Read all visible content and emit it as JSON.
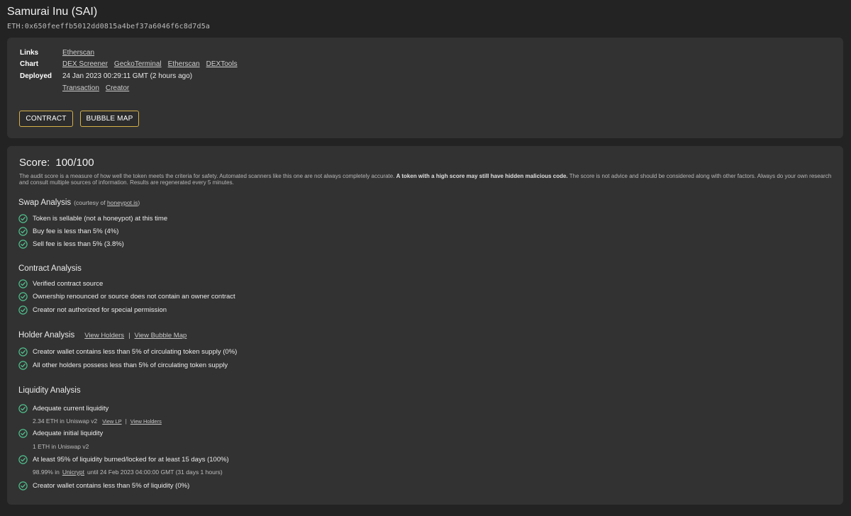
{
  "token": {
    "name": "Samurai Inu (SAI)",
    "address": "ETH:0x650feeffb5012dd0815a4bef37a6046f6c8d7d5a"
  },
  "info": {
    "links_label": "Links",
    "links": [
      "Etherscan"
    ],
    "chart_label": "Chart",
    "charts": [
      "DEX Screener",
      "GeckoTerminal",
      "Etherscan",
      "DEXTools"
    ],
    "deployed_label": "Deployed",
    "deployed_value": "24 Jan 2023 00:29:11 GMT (2 hours ago)",
    "deployed_links": [
      "Transaction",
      "Creator"
    ],
    "buttons": {
      "contract": "CONTRACT",
      "bubble_map": "BUBBLE MAP"
    }
  },
  "score": {
    "label": "Score:",
    "value": "100/100",
    "desc_a": "The audit score is a measure of how well the token meets the criteria for safety.  Automated scanners like this one are not always completely accurate.  ",
    "desc_bold": "A token with a high score may still have hidden malicious code.",
    "desc_b": " The score is not advice and should be considered along with other factors. Always do your own research and consult multiple sources of information.  Results are regenerated every 5 minutes."
  },
  "swap": {
    "title": "Swap Analysis",
    "courtesy": "(courtesy of",
    "courtesy_link": "honeypot.is",
    "courtesy_end": ")",
    "items": [
      "Token is sellable (not a honeypot) at this time",
      "Buy fee is less than 5% (4%)",
      "Sell fee is less than 5% (3.8%)"
    ]
  },
  "contract": {
    "title": "Contract Analysis",
    "items": [
      "Verified contract source",
      "Ownership renounced or source does not contain an owner contract",
      "Creator not authorized for special permission"
    ]
  },
  "holder": {
    "title": "Holder Analysis",
    "link_holders": "View Holders",
    "separator": "|",
    "link_bubble": "View Bubble Map",
    "items": [
      "Creator wallet contains less than 5% of circulating token supply (0%)",
      "All other holders possess less than 5% of circulating token supply"
    ]
  },
  "liquidity": {
    "title": "Liquidity Analysis",
    "items": [
      "Adequate current liquidity",
      "Adequate initial liquidity",
      "At least 95% of liquidity burned/locked for at least 15 days (100%)",
      "Creator wallet contains less than 5% of liquidity (0%)"
    ],
    "current_detail": "2.34 ETH in Uniswap v2",
    "view_lp": "View LP",
    "detail_sep": "|",
    "view_holders": "View Holders",
    "initial_detail": "1 ETH in Uniswap v2",
    "lock_pct": "98.99% in",
    "lock_link": "Unicrypt",
    "lock_until": "until 24 Feb 2023 04:00:00 GMT (31 days 1 hours)"
  },
  "colors": {
    "background": "#232323",
    "panel": "#323232",
    "button_border": "#d6b14a",
    "check_green": "#4fc08d"
  },
  "icons": {
    "check": "check-circle-icon"
  }
}
